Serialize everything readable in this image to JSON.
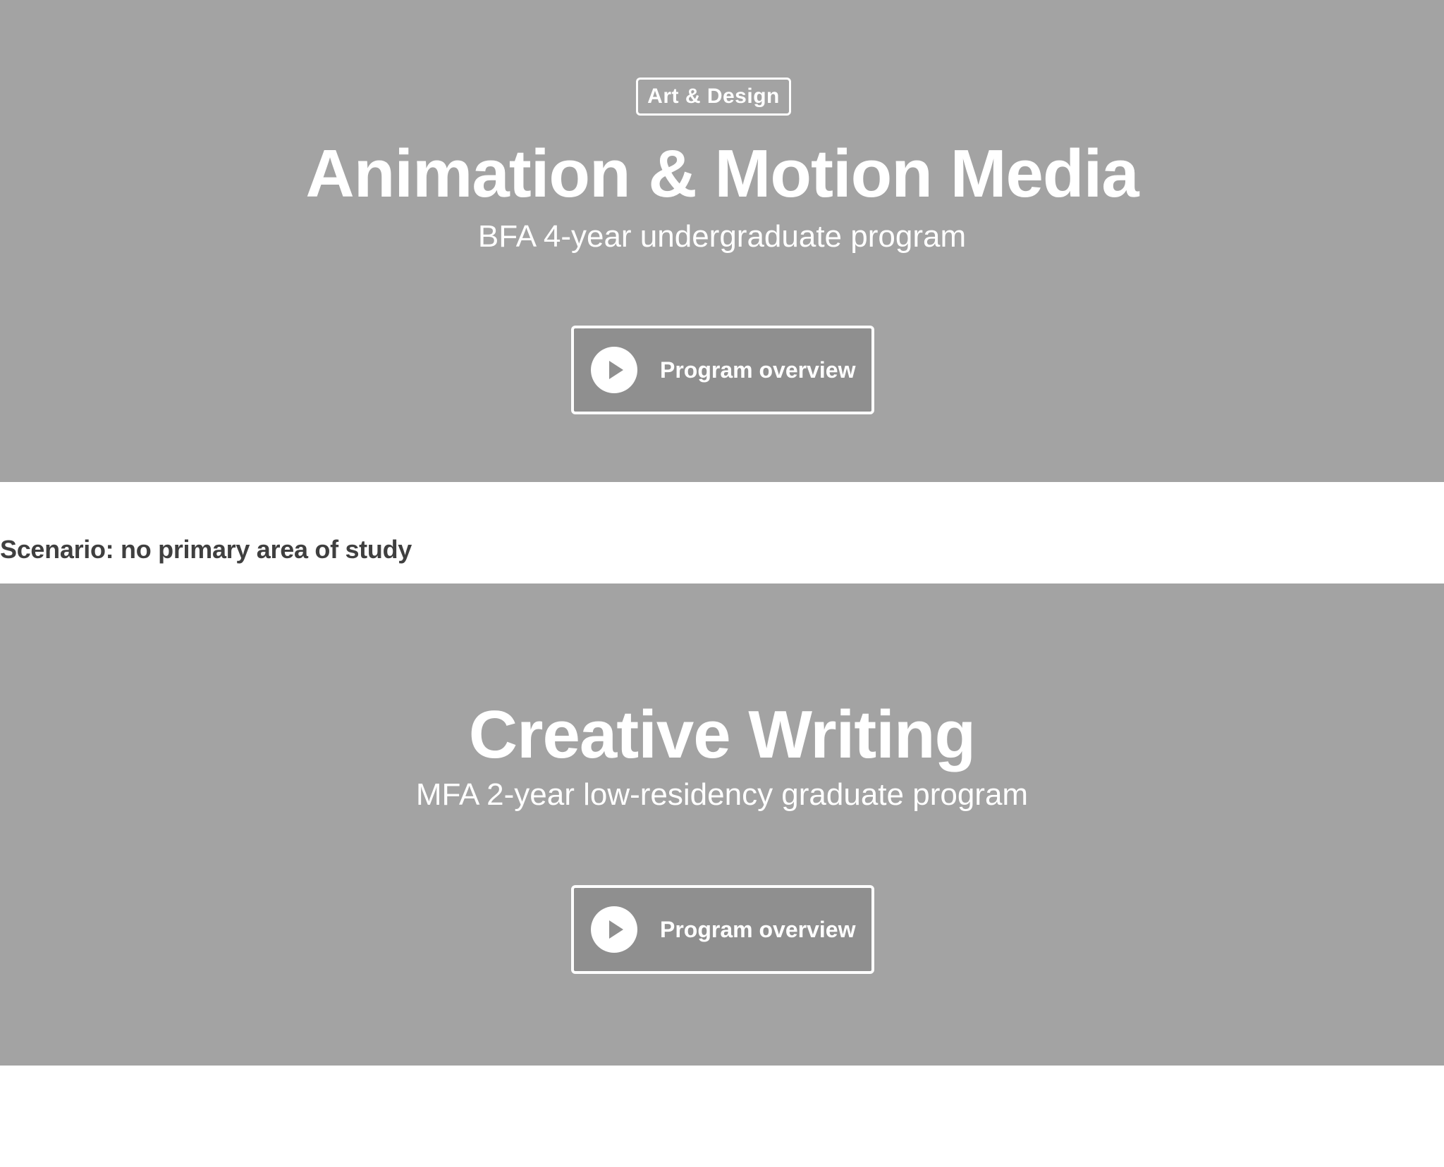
{
  "hero_primary": {
    "tag": "Art & Design",
    "title": "Animation & Motion Media",
    "subtitle": "BFA 4-year undergraduate program",
    "button": {
      "label": "Program overview",
      "icon": "play-icon"
    }
  },
  "scenario": {
    "heading": "Scenario: no primary area of study"
  },
  "hero_secondary": {
    "title": "Creative Writing",
    "subtitle": "MFA 2-year low-residency graduate program",
    "button": {
      "label": "Program overview",
      "icon": "play-icon"
    }
  },
  "colors": {
    "hero_background": "#a3a3a3",
    "button_background": "#8f8f8f",
    "text_light": "#ffffff",
    "text_dark": "#3f3f3f"
  }
}
